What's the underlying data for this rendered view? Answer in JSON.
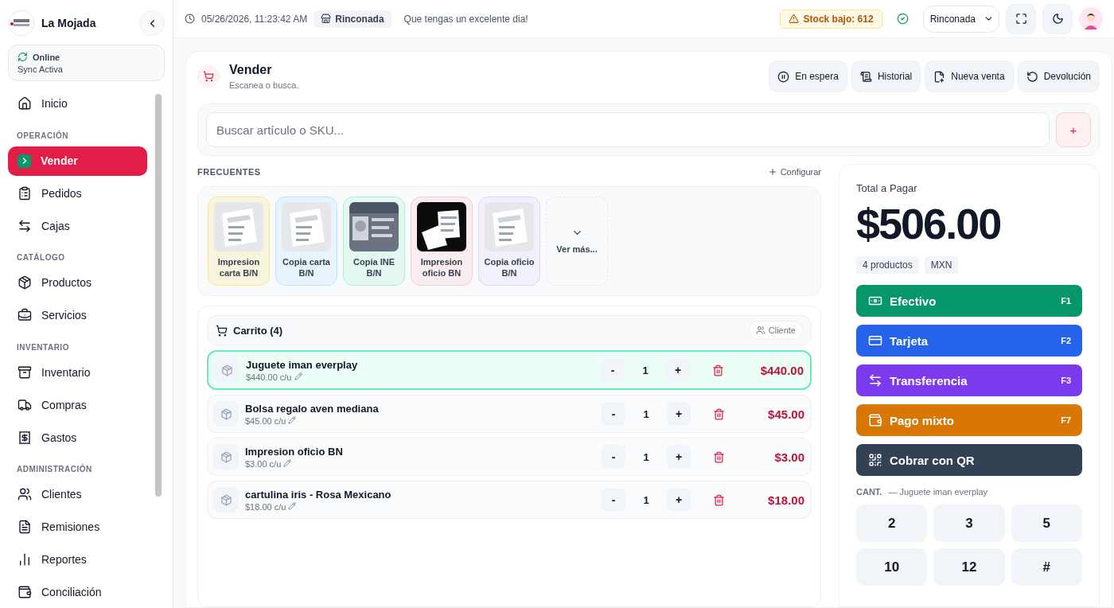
{
  "sidebar": {
    "brand": "La Mojada",
    "sync": {
      "status": "Online",
      "detail": "Sync Activa"
    },
    "sections": [
      {
        "items": [
          {
            "label": "Inicio",
            "selected": false
          }
        ]
      },
      {
        "title": "OPERACIÓN",
        "items": [
          {
            "label": "Vender",
            "selected": true
          },
          {
            "label": "Pedidos",
            "selected": false
          },
          {
            "label": "Cajas",
            "selected": false
          }
        ]
      },
      {
        "title": "CATÁLOGO",
        "items": [
          {
            "label": "Productos",
            "selected": false
          },
          {
            "label": "Servicios",
            "selected": false
          }
        ]
      },
      {
        "title": "INVENTARIO",
        "items": [
          {
            "label": "Inventario",
            "selected": false
          },
          {
            "label": "Compras",
            "selected": false
          },
          {
            "label": "Gastos",
            "selected": false
          }
        ]
      },
      {
        "title": "ADMINISTRACIÓN",
        "items": [
          {
            "label": "Clientes",
            "selected": false
          },
          {
            "label": "Remisiones",
            "selected": false
          },
          {
            "label": "Reportes",
            "selected": false
          },
          {
            "label": "Conciliación",
            "selected": false
          }
        ]
      }
    ]
  },
  "topbar": {
    "datetime": "05/26/2026, 11:23:42 AM",
    "branch": "Rinconada",
    "greeting": "Que tengas un excelente dia!",
    "stock_alert": "Stock bajo: 612",
    "branch_select": "Rinconada"
  },
  "page": {
    "title": "Vender",
    "subtitle": "Escanea o busca.",
    "actions": [
      "En espera",
      "Historial",
      "Nueva venta",
      "Devolución"
    ]
  },
  "search": {
    "placeholder": "Buscar artículo o SKU...",
    "add": "+"
  },
  "frequent": {
    "title": "FRECUENTES",
    "configure": "Configurar",
    "items": [
      {
        "kind": "product",
        "label": "Impresion carta B/N",
        "color": "#fde68a"
      },
      {
        "kind": "product",
        "label": "Copia carta B/N",
        "color": "#bae6fd"
      },
      {
        "kind": "product",
        "label": "Copia INE B/N",
        "color": "#a7f3d0"
      },
      {
        "kind": "product",
        "label": "Impresion oficio BN",
        "color": "#fecaca"
      },
      {
        "kind": "product",
        "label": "Copia oficio B/N",
        "color": "#ddd6fe"
      },
      {
        "kind": "more",
        "label": "Ver más..."
      }
    ]
  },
  "cart": {
    "title": "Carrito (4)",
    "client": "Cliente",
    "rows": [
      {
        "name": "Juguete iman everplay",
        "unit": "$440.00 c/u",
        "qty": "1",
        "total": "$440.00",
        "selected": true
      },
      {
        "name": "Bolsa regalo aven mediana",
        "unit": "$45.00 c/u",
        "qty": "1",
        "total": "$45.00",
        "selected": false
      },
      {
        "name": "Impresion oficio BN",
        "unit": "$3.00 c/u",
        "qty": "1",
        "total": "$3.00",
        "selected": false
      },
      {
        "name": "cartulina iris - Rosa Mexicano",
        "unit": "$18.00 c/u",
        "qty": "1",
        "total": "$18.00",
        "selected": false
      }
    ],
    "minus": "-",
    "plus": "+"
  },
  "payment": {
    "label": "Total a Pagar",
    "total": "$506.00",
    "tags": [
      "4 productos",
      "MXN"
    ],
    "methods": [
      {
        "label": "Efectivo",
        "key": "F1",
        "color": "#059669"
      },
      {
        "label": "Tarjeta",
        "key": "F2",
        "color": "#2563eb"
      },
      {
        "label": "Transferencia",
        "key": "F3",
        "color": "#7c3aed"
      },
      {
        "label": "Pago mixto",
        "key": "F7",
        "color": "#d97706"
      },
      {
        "label": "Cobrar con QR",
        "color": "#334155"
      }
    ],
    "qty_label": "CANT.",
    "qty_item": "— Juguete iman everplay",
    "keys": [
      "2",
      "3",
      "5",
      "10",
      "12",
      "#"
    ]
  }
}
